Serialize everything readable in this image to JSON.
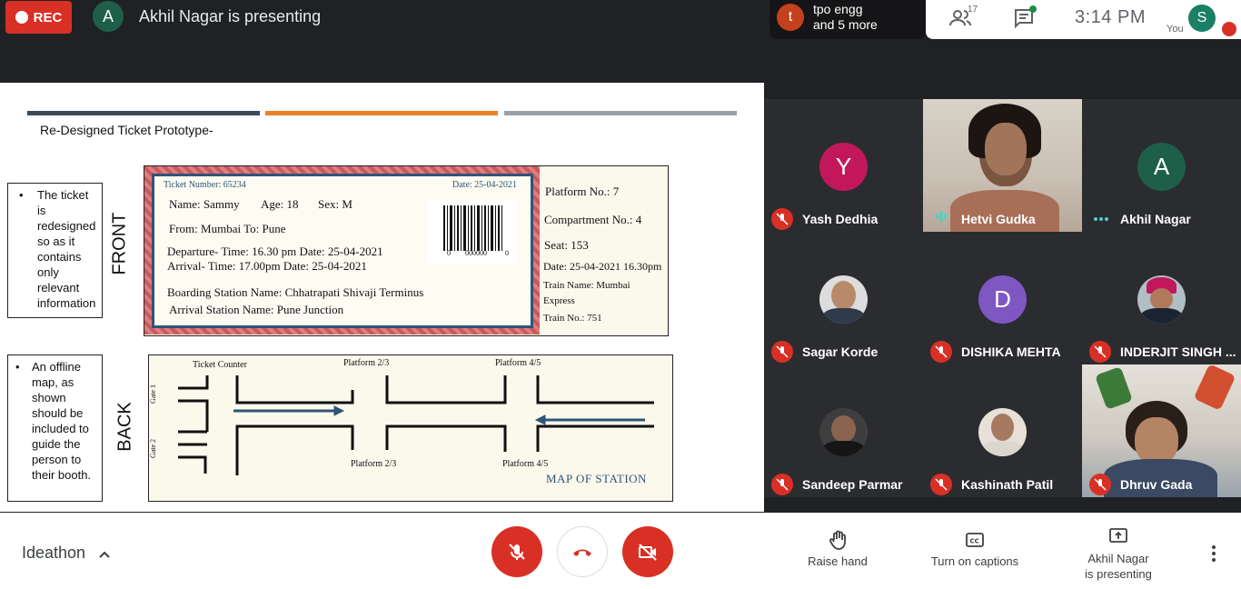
{
  "top": {
    "rec_label": "REC",
    "presenter_initial": "A",
    "presenting_text": "Akhil Nagar is presenting",
    "tpo_initial": "t",
    "tpo_line1": "tpo engg",
    "tpo_line2": "and 5 more",
    "people_count": "17",
    "time": "3:14 PM",
    "you_initial": "S",
    "you_label": "You"
  },
  "slide": {
    "title": "Re-Designed Ticket Prototype-",
    "bar_colors": [
      "#3b4a56",
      "#e8832a",
      "#9aa0a6"
    ],
    "front_label": "FRONT",
    "back_label": "BACK",
    "note_front": "The ticket is redesigned so as it contains only relevant information",
    "note_back": "An offline map, as shown should be included to guide the person to their booth.",
    "bullet": "•",
    "ticket": {
      "number": "Ticket Number: 65234",
      "date": "Date: 25-04-2021",
      "name": "Name: Sammy",
      "age": "Age: 18",
      "sex": "Sex: M",
      "from_to": "From: Mumbai To: Pune",
      "departure": "Departure- Time: 16.30 pm   Date: 25-04-2021",
      "arrival": "Arrival- Time: 17.00pm   Date: 25-04-2021",
      "boarding": "Boarding Station Name: Chhatrapati Shivaji Terminus",
      "arrival_station": "Arrival Station Name: Pune Junction",
      "barcode_left": "0",
      "barcode_number": "000000",
      "barcode_right": "0",
      "platform": "Platform No.: 7",
      "compartment": "Compartment No.: 4",
      "seat": "Seat: 153",
      "date_time": "Date: 25-04-2021 16.30pm",
      "train_name_1": "Train Name: Mumbai",
      "train_name_2": "Express",
      "train_no": "Train No.: 751"
    },
    "map": {
      "ticket_counter": "Ticket Counter",
      "platform_23_top": "Platform 2/3",
      "platform_45_top": "Platform 4/5",
      "platform_23_bottom": "Platform 2/3",
      "platform_45_bottom": "Platform 4/5",
      "gate1": "Gate 1",
      "gate2": "Gate 2",
      "title": "MAP OF STATION"
    }
  },
  "participants": [
    {
      "name": "Yash Dedhia",
      "initial": "Y",
      "color": "#c2185b",
      "muted": true
    },
    {
      "name": "Hetvi Gudka",
      "initial": "",
      "color": "",
      "muted": false,
      "speaking": true,
      "video": true
    },
    {
      "name": "Akhil Nagar",
      "initial": "A",
      "color": "#1e5f4a",
      "muted": false,
      "presenting": true
    },
    {
      "name": "Sagar Korde",
      "initial": "",
      "color": "#dcdcdc",
      "muted": true,
      "photo": true
    },
    {
      "name": "DISHIKA MEHTA",
      "initial": "D",
      "color": "#7e57c2",
      "muted": true
    },
    {
      "name": "INDERJIT SINGH ...",
      "initial": "",
      "color": "#b0bec5",
      "muted": true,
      "photo": true
    },
    {
      "name": "Sandeep Parmar",
      "initial": "",
      "color": "#3e3e3e",
      "muted": true,
      "photo": true
    },
    {
      "name": "Kashinath Patil",
      "initial": "",
      "color": "#d7ccc8",
      "muted": true,
      "photo": true
    },
    {
      "name": "Dhruv Gada",
      "initial": "",
      "color": "",
      "muted": true,
      "video": true
    }
  ],
  "bottom": {
    "meeting_name": "Ideathon",
    "raise_hand": "Raise hand",
    "captions": "Turn on captions",
    "presenting_line1": "Akhil Nagar",
    "presenting_line2": "is presenting"
  }
}
